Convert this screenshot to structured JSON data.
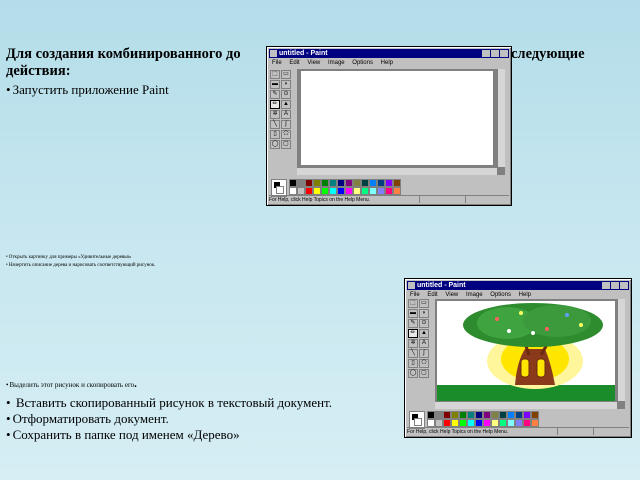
{
  "heading": {
    "line1_start": "Для создания комбинированного  до",
    "line1_end": "следующие",
    "line2": "действия:"
  },
  "steps": {
    "launch_paint": "Запустить приложение Paint",
    "open_picture": "Открыть картинку для примеры «Удивительные деревья»",
    "draw_tree": "Начертить описание дерева и нарисовать соответствующий рисунок.",
    "copy_picture": "Выделить этот рисунок и скопировать его",
    "paste_picture": " Вставить скопированный рисунок  в текстовый документ.",
    "format_document": "Отформатировать документ.",
    "save_document": "Сохранить в папке под именем «Дерево»"
  },
  "paint_window_1": {
    "title": "untitled - Paint",
    "menu": [
      "File",
      "Edit",
      "View",
      "Image",
      "Options",
      "Help"
    ],
    "status": "For Help, click Help Topics on the Help Menu."
  },
  "paint_window_2": {
    "title": "untitled - Paint",
    "menu": [
      "File",
      "Edit",
      "View",
      "Image",
      "Options",
      "Help"
    ],
    "status": "For Help, click Help Topics on the Help Menu."
  },
  "tool_icons": [
    "free-select-icon",
    "select-icon",
    "eraser-icon",
    "fill-icon",
    "picker-icon",
    "magnifier-icon",
    "pencil-icon",
    "brush-icon",
    "airbrush-icon",
    "text-icon",
    "line-icon",
    "curve-icon",
    "rectangle-icon",
    "polygon-icon",
    "ellipse-icon",
    "rounded-rect-icon"
  ],
  "palette_colors": [
    "#000000",
    "#808080",
    "#800000",
    "#808000",
    "#008000",
    "#008080",
    "#000080",
    "#800080",
    "#808040",
    "#004040",
    "#0080ff",
    "#004080",
    "#8000ff",
    "#804000",
    "#ffffff",
    "#c0c0c0",
    "#ff0000",
    "#ffff00",
    "#00ff00",
    "#00ffff",
    "#0000ff",
    "#ff00ff",
    "#ffff80",
    "#00ff80",
    "#80ffff",
    "#8080ff",
    "#ff0080",
    "#ff8040"
  ]
}
